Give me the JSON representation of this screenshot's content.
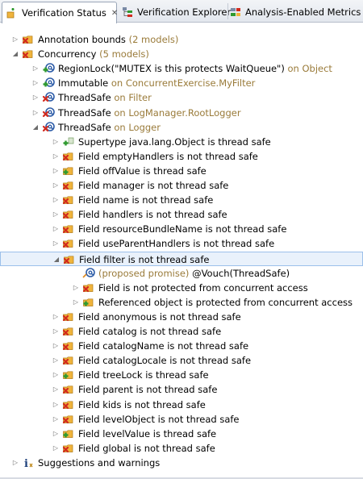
{
  "tabs": [
    {
      "label": "Verification Status",
      "icon": "verification-status-icon",
      "active": true
    },
    {
      "label": "Verification Explorer",
      "icon": "verification-explorer-icon",
      "active": false
    },
    {
      "label": "Analysis-Enabled Metrics",
      "icon": "metrics-icon",
      "active": false
    }
  ],
  "tree": [
    {
      "depth": 0,
      "twisty": "collapsed",
      "icon": "folder-red-x",
      "label": "Annotation bounds",
      "suffix": "(2 models)"
    },
    {
      "depth": 0,
      "twisty": "expanded",
      "icon": "folder-red-x",
      "label": "Concurrency",
      "suffix": "(5 models)"
    },
    {
      "depth": 1,
      "twisty": "collapsed",
      "icon": "at-green-plus",
      "label": "RegionLock(\"MUTEX is this protects WaitQueue\")",
      "suffix": "on Object"
    },
    {
      "depth": 1,
      "twisty": "collapsed",
      "icon": "at-green-plus",
      "label": "Immutable",
      "suffix": "on ConcurrentExercise.MyFilter"
    },
    {
      "depth": 1,
      "twisty": "collapsed",
      "icon": "at-red-x",
      "label": "ThreadSafe",
      "suffix": "on Filter"
    },
    {
      "depth": 1,
      "twisty": "collapsed",
      "icon": "at-red-x",
      "label": "ThreadSafe",
      "suffix": "on LogManager.RootLogger"
    },
    {
      "depth": 1,
      "twisty": "expanded",
      "icon": "at-red-x",
      "label": "ThreadSafe",
      "suffix": "on Logger"
    },
    {
      "depth": 2,
      "twisty": "collapsed",
      "icon": "green-plus-result",
      "label": "Supertype java.lang.Object is thread safe",
      "suffix": ""
    },
    {
      "depth": 2,
      "twisty": "collapsed",
      "icon": "folder-red-x",
      "label": "Field emptyHandlers is not thread safe",
      "suffix": ""
    },
    {
      "depth": 2,
      "twisty": "collapsed",
      "icon": "folder-green-plus",
      "label": "Field offValue is thread safe",
      "suffix": ""
    },
    {
      "depth": 2,
      "twisty": "collapsed",
      "icon": "folder-red-x",
      "label": "Field manager is not thread safe",
      "suffix": ""
    },
    {
      "depth": 2,
      "twisty": "collapsed",
      "icon": "folder-red-x",
      "label": "Field name is not thread safe",
      "suffix": ""
    },
    {
      "depth": 2,
      "twisty": "collapsed",
      "icon": "folder-red-x",
      "label": "Field handlers is not thread safe",
      "suffix": ""
    },
    {
      "depth": 2,
      "twisty": "collapsed",
      "icon": "folder-red-x",
      "label": "Field resourceBundleName is not thread safe",
      "suffix": ""
    },
    {
      "depth": 2,
      "twisty": "collapsed",
      "icon": "folder-red-x",
      "label": "Field useParentHandlers is not thread safe",
      "suffix": ""
    },
    {
      "depth": 2,
      "twisty": "expanded",
      "icon": "folder-red-x",
      "label": "Field filter is not thread safe",
      "suffix": "",
      "selected": true
    },
    {
      "depth": 3,
      "twisty": "none",
      "icon": "at-proposed",
      "label": "@Vouch(ThreadSafe)",
      "prefix": "(proposed promise)",
      "suffix": ""
    },
    {
      "depth": 3,
      "twisty": "collapsed",
      "icon": "folder-red-x",
      "label": "Field is not protected from concurrent access",
      "suffix": ""
    },
    {
      "depth": 3,
      "twisty": "collapsed",
      "icon": "folder-green-plus",
      "label": "Referenced object is protected from concurrent access",
      "suffix": ""
    },
    {
      "depth": 2,
      "twisty": "collapsed",
      "icon": "folder-red-x",
      "label": "Field anonymous is not thread safe",
      "suffix": ""
    },
    {
      "depth": 2,
      "twisty": "collapsed",
      "icon": "folder-red-x",
      "label": "Field catalog is not thread safe",
      "suffix": ""
    },
    {
      "depth": 2,
      "twisty": "collapsed",
      "icon": "folder-red-x",
      "label": "Field catalogName is not thread safe",
      "suffix": ""
    },
    {
      "depth": 2,
      "twisty": "collapsed",
      "icon": "folder-red-x",
      "label": "Field catalogLocale is not thread safe",
      "suffix": ""
    },
    {
      "depth": 2,
      "twisty": "collapsed",
      "icon": "folder-green-plus",
      "label": "Field treeLock is thread safe",
      "suffix": ""
    },
    {
      "depth": 2,
      "twisty": "collapsed",
      "icon": "folder-red-x",
      "label": "Field parent is not thread safe",
      "suffix": ""
    },
    {
      "depth": 2,
      "twisty": "collapsed",
      "icon": "folder-red-x",
      "label": "Field kids is not thread safe",
      "suffix": ""
    },
    {
      "depth": 2,
      "twisty": "collapsed",
      "icon": "folder-red-x",
      "label": "Field levelObject is not thread safe",
      "suffix": ""
    },
    {
      "depth": 2,
      "twisty": "collapsed",
      "icon": "folder-green-plus",
      "label": "Field levelValue is thread safe",
      "suffix": ""
    },
    {
      "depth": 2,
      "twisty": "collapsed",
      "icon": "folder-red-x",
      "label": "Field global is not thread safe",
      "suffix": ""
    },
    {
      "depth": 0,
      "twisty": "collapsed",
      "icon": "info",
      "label": "Suggestions and warnings",
      "suffix": ""
    }
  ],
  "colors": {
    "selection_bg": "#e9f1fb",
    "selection_border": "#9cc0ea",
    "suffix_text": "#9a7b3a",
    "folder": "#f0b43c",
    "error_x": "#d22a1e",
    "ok_plus": "#2f9a2f",
    "at_blue": "#2e5da8"
  }
}
